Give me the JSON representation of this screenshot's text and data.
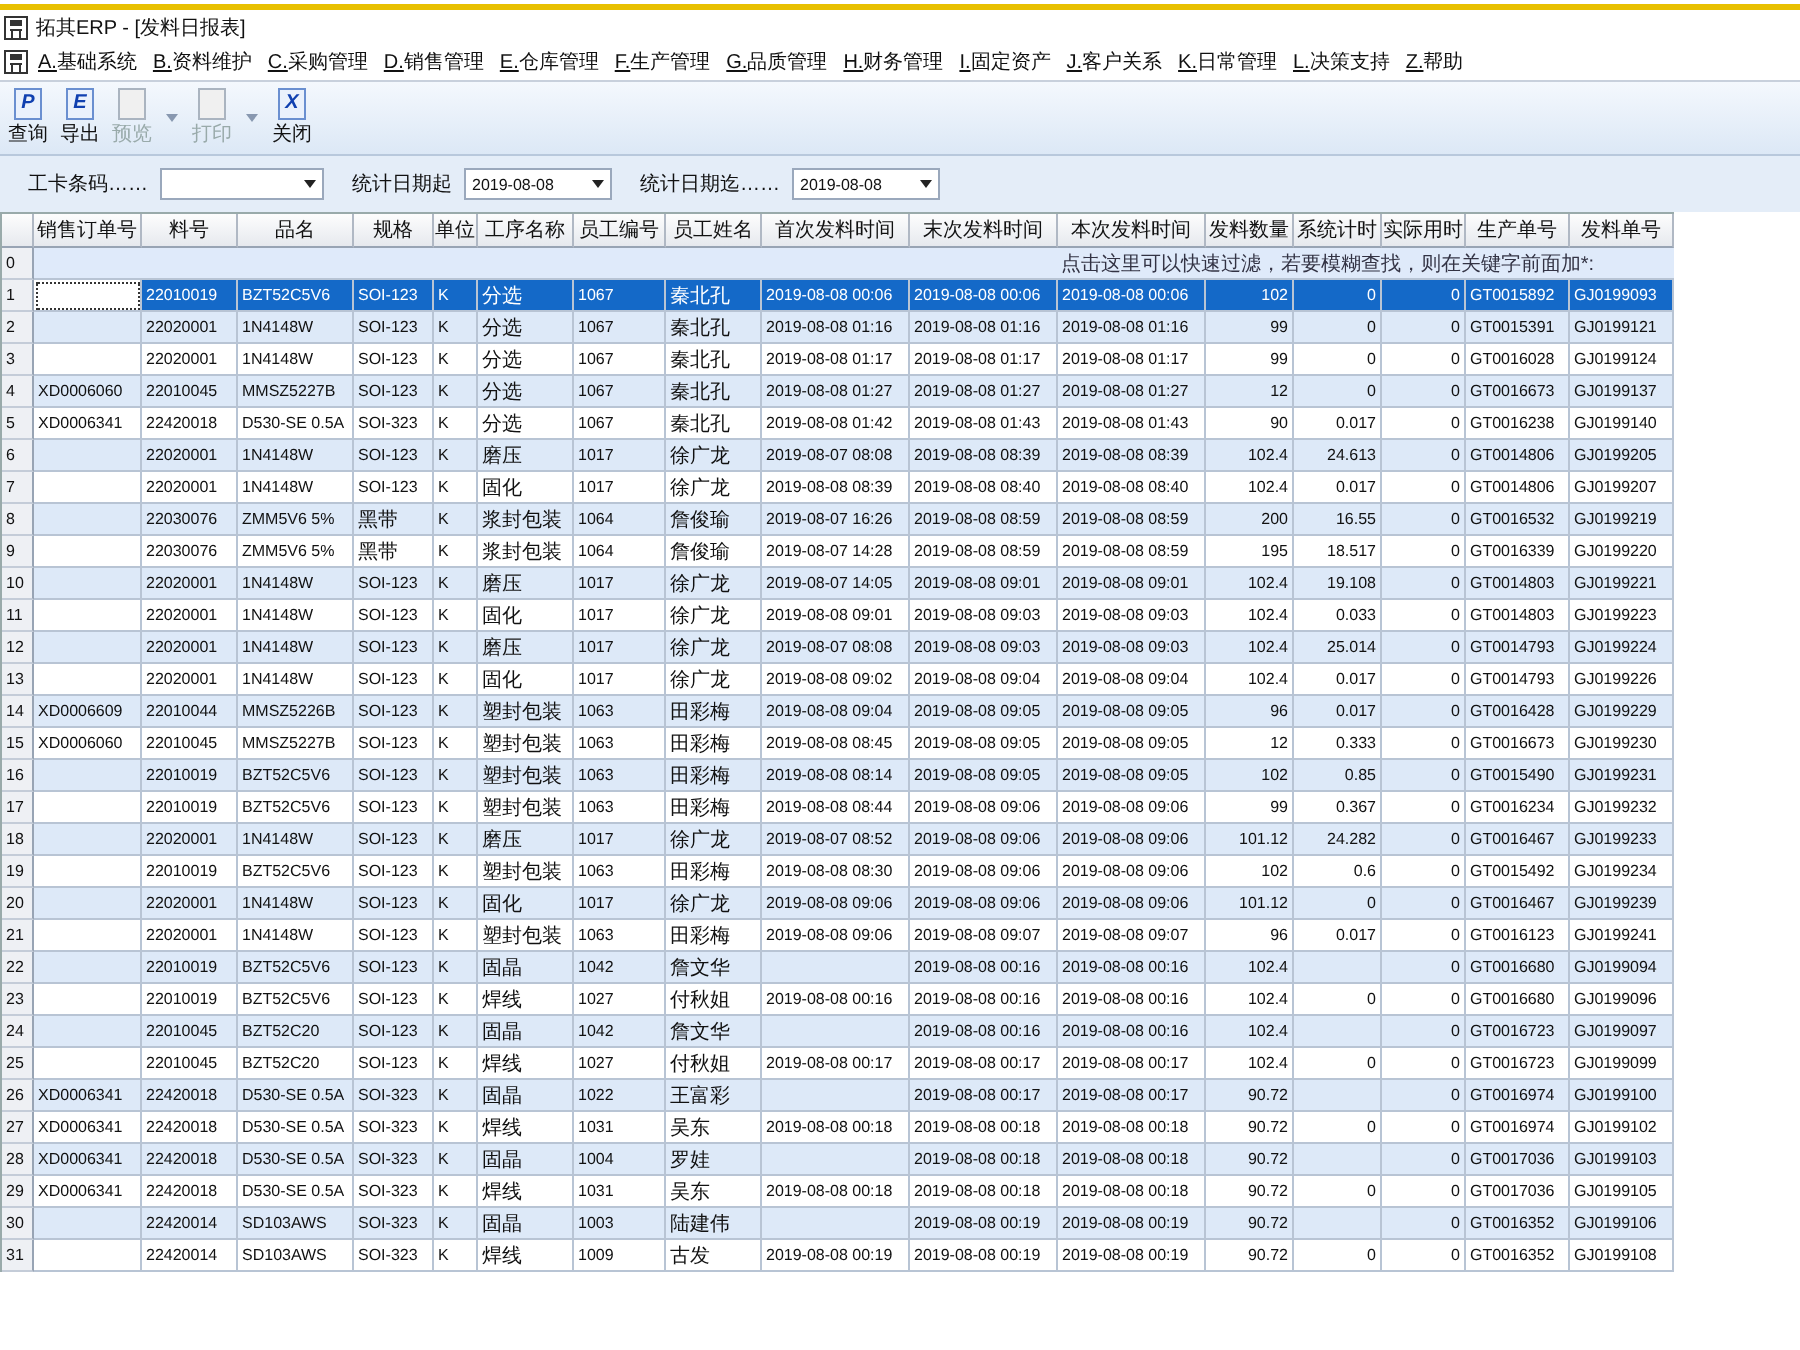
{
  "window": {
    "title": "拓其ERP - [发料日报表]"
  },
  "menu": [
    {
      "label": "A.基础系统"
    },
    {
      "label": "B.资料维护"
    },
    {
      "label": "C.采购管理"
    },
    {
      "label": "D.销售管理"
    },
    {
      "label": "E.仓库管理"
    },
    {
      "label": "F.生产管理"
    },
    {
      "label": "G.品质管理"
    },
    {
      "label": "H.财务管理"
    },
    {
      "label": "I.固定资产"
    },
    {
      "label": "J.客户关系"
    },
    {
      "label": "K.日常管理"
    },
    {
      "label": "L.决策支持"
    },
    {
      "label": "Z.帮助"
    }
  ],
  "toolbar": [
    {
      "glyph": "P",
      "label": "查询",
      "disabled": false,
      "dropdown": false
    },
    {
      "glyph": "E",
      "label": "导出",
      "disabled": false,
      "dropdown": false
    },
    {
      "label": "预览",
      "disabled": true,
      "dropdown": true
    },
    {
      "label": "打印",
      "disabled": true,
      "dropdown": true
    },
    {
      "glyph": "X",
      "label": "关闭",
      "disabled": false,
      "dropdown": false
    }
  ],
  "filters": [
    {
      "label": "工卡条码……"
    },
    {
      "label": "统计日期起",
      "value": "2019-08-08"
    },
    {
      "label": "统计日期迄……",
      "value": "2019-08-08"
    }
  ],
  "table": {
    "columns": [
      {
        "label": "销售订单号",
        "kind": "text"
      },
      {
        "label": "料号",
        "kind": "text"
      },
      {
        "label": "品名",
        "kind": "text"
      },
      {
        "label": "规格",
        "kind": "text"
      },
      {
        "label": "单位",
        "kind": "text"
      },
      {
        "label": "工序名称",
        "kind": "text"
      },
      {
        "label": "员工编号",
        "kind": "text"
      },
      {
        "label": "员工姓名",
        "kind": "text"
      },
      {
        "label": "首次发料时间",
        "kind": "text"
      },
      {
        "label": "末次发料时间",
        "kind": "text"
      },
      {
        "label": "本次发料时间",
        "kind": "text"
      },
      {
        "label": "发料数量",
        "kind": "number"
      },
      {
        "label": "系统计时",
        "kind": "number"
      },
      {
        "label": "实际用时",
        "kind": "number"
      },
      {
        "label": "生产单号",
        "kind": "text"
      },
      {
        "label": "发料单号",
        "kind": "text"
      }
    ],
    "filter_row": {
      "number": "0",
      "hint": "点击这里可以快速过滤，若要模糊查找，则在关键字前面加*:"
    },
    "rows": [
      {
        "number": "1",
        "selected": true,
        "cells": [
          "",
          "22010019",
          "BZT52C5V6",
          "SOI-123",
          "K",
          "分选",
          "1067",
          "秦北孔",
          "2019-08-08 00:06",
          "2019-08-08 00:06",
          "2019-08-08 00:06",
          "102",
          "0",
          "0",
          "GT0015892",
          "GJ0199093"
        ]
      },
      {
        "number": "2",
        "selected": false,
        "cells": [
          "",
          "22020001",
          "1N4148W",
          "SOI-123",
          "K",
          "分选",
          "1067",
          "秦北孔",
          "2019-08-08 01:16",
          "2019-08-08 01:16",
          "2019-08-08 01:16",
          "99",
          "0",
          "0",
          "GT0015391",
          "GJ0199121"
        ]
      },
      {
        "number": "3",
        "selected": false,
        "cells": [
          "",
          "22020001",
          "1N4148W",
          "SOI-123",
          "K",
          "分选",
          "1067",
          "秦北孔",
          "2019-08-08 01:17",
          "2019-08-08 01:17",
          "2019-08-08 01:17",
          "99",
          "0",
          "0",
          "GT0016028",
          "GJ0199124"
        ]
      },
      {
        "number": "4",
        "selected": false,
        "cells": [
          "XD0006060",
          "22010045",
          "MMSZ5227B",
          "SOI-123",
          "K",
          "分选",
          "1067",
          "秦北孔",
          "2019-08-08 01:27",
          "2019-08-08 01:27",
          "2019-08-08 01:27",
          "12",
          "0",
          "0",
          "GT0016673",
          "GJ0199137"
        ]
      },
      {
        "number": "5",
        "selected": false,
        "cells": [
          "XD0006341",
          "22420018",
          "D530-SE 0.5A",
          "SOI-323",
          "K",
          "分选",
          "1067",
          "秦北孔",
          "2019-08-08 01:42",
          "2019-08-08 01:43",
          "2019-08-08 01:43",
          "90",
          "0.017",
          "0",
          "GT0016238",
          "GJ0199140"
        ]
      },
      {
        "number": "6",
        "selected": false,
        "cells": [
          "",
          "22020001",
          "1N4148W",
          "SOI-123",
          "K",
          "磨压",
          "1017",
          "徐广龙",
          "2019-08-07 08:08",
          "2019-08-08 08:39",
          "2019-08-08 08:39",
          "102.4",
          "24.613",
          "0",
          "GT0014806",
          "GJ0199205"
        ]
      },
      {
        "number": "7",
        "selected": false,
        "cells": [
          "",
          "22020001",
          "1N4148W",
          "SOI-123",
          "K",
          "固化",
          "1017",
          "徐广龙",
          "2019-08-08 08:39",
          "2019-08-08 08:40",
          "2019-08-08 08:40",
          "102.4",
          "0.017",
          "0",
          "GT0014806",
          "GJ0199207"
        ]
      },
      {
        "number": "8",
        "selected": false,
        "cells": [
          "",
          "22030076",
          "ZMM5V6 5%",
          "黑带",
          "K",
          "浆封包装",
          "1064",
          "詹俊瑜",
          "2019-08-07 16:26",
          "2019-08-08 08:59",
          "2019-08-08 08:59",
          "200",
          "16.55",
          "0",
          "GT0016532",
          "GJ0199219"
        ]
      },
      {
        "number": "9",
        "selected": false,
        "cells": [
          "",
          "22030076",
          "ZMM5V6 5%",
          "黑带",
          "K",
          "浆封包装",
          "1064",
          "詹俊瑜",
          "2019-08-07 14:28",
          "2019-08-08 08:59",
          "2019-08-08 08:59",
          "195",
          "18.517",
          "0",
          "GT0016339",
          "GJ0199220"
        ]
      },
      {
        "number": "10",
        "selected": false,
        "cells": [
          "",
          "22020001",
          "1N4148W",
          "SOI-123",
          "K",
          "磨压",
          "1017",
          "徐广龙",
          "2019-08-07 14:05",
          "2019-08-08 09:01",
          "2019-08-08 09:01",
          "102.4",
          "19.108",
          "0",
          "GT0014803",
          "GJ0199221"
        ]
      },
      {
        "number": "11",
        "selected": false,
        "cells": [
          "",
          "22020001",
          "1N4148W",
          "SOI-123",
          "K",
          "固化",
          "1017",
          "徐广龙",
          "2019-08-08 09:01",
          "2019-08-08 09:03",
          "2019-08-08 09:03",
          "102.4",
          "0.033",
          "0",
          "GT0014803",
          "GJ0199223"
        ]
      },
      {
        "number": "12",
        "selected": false,
        "cells": [
          "",
          "22020001",
          "1N4148W",
          "SOI-123",
          "K",
          "磨压",
          "1017",
          "徐广龙",
          "2019-08-07 08:08",
          "2019-08-08 09:03",
          "2019-08-08 09:03",
          "102.4",
          "25.014",
          "0",
          "GT0014793",
          "GJ0199224"
        ]
      },
      {
        "number": "13",
        "selected": false,
        "cells": [
          "",
          "22020001",
          "1N4148W",
          "SOI-123",
          "K",
          "固化",
          "1017",
          "徐广龙",
          "2019-08-08 09:02",
          "2019-08-08 09:04",
          "2019-08-08 09:04",
          "102.4",
          "0.017",
          "0",
          "GT0014793",
          "GJ0199226"
        ]
      },
      {
        "number": "14",
        "selected": false,
        "cells": [
          "XD0006609",
          "22010044",
          "MMSZ5226B",
          "SOI-123",
          "K",
          "塑封包装",
          "1063",
          "田彩梅",
          "2019-08-08 09:04",
          "2019-08-08 09:05",
          "2019-08-08 09:05",
          "96",
          "0.017",
          "0",
          "GT0016428",
          "GJ0199229"
        ]
      },
      {
        "number": "15",
        "selected": false,
        "cells": [
          "XD0006060",
          "22010045",
          "MMSZ5227B",
          "SOI-123",
          "K",
          "塑封包装",
          "1063",
          "田彩梅",
          "2019-08-08 08:45",
          "2019-08-08 09:05",
          "2019-08-08 09:05",
          "12",
          "0.333",
          "0",
          "GT0016673",
          "GJ0199230"
        ]
      },
      {
        "number": "16",
        "selected": false,
        "cells": [
          "",
          "22010019",
          "BZT52C5V6",
          "SOI-123",
          "K",
          "塑封包装",
          "1063",
          "田彩梅",
          "2019-08-08 08:14",
          "2019-08-08 09:05",
          "2019-08-08 09:05",
          "102",
          "0.85",
          "0",
          "GT0015490",
          "GJ0199231"
        ]
      },
      {
        "number": "17",
        "selected": false,
        "cells": [
          "",
          "22010019",
          "BZT52C5V6",
          "SOI-123",
          "K",
          "塑封包装",
          "1063",
          "田彩梅",
          "2019-08-08 08:44",
          "2019-08-08 09:06",
          "2019-08-08 09:06",
          "99",
          "0.367",
          "0",
          "GT0016234",
          "GJ0199232"
        ]
      },
      {
        "number": "18",
        "selected": false,
        "cells": [
          "",
          "22020001",
          "1N4148W",
          "SOI-123",
          "K",
          "磨压",
          "1017",
          "徐广龙",
          "2019-08-07 08:52",
          "2019-08-08 09:06",
          "2019-08-08 09:06",
          "101.12",
          "24.282",
          "0",
          "GT0016467",
          "GJ0199233"
        ]
      },
      {
        "number": "19",
        "selected": false,
        "cells": [
          "",
          "22010019",
          "BZT52C5V6",
          "SOI-123",
          "K",
          "塑封包装",
          "1063",
          "田彩梅",
          "2019-08-08 08:30",
          "2019-08-08 09:06",
          "2019-08-08 09:06",
          "102",
          "0.6",
          "0",
          "GT0015492",
          "GJ0199234"
        ]
      },
      {
        "number": "20",
        "selected": false,
        "cells": [
          "",
          "22020001",
          "1N4148W",
          "SOI-123",
          "K",
          "固化",
          "1017",
          "徐广龙",
          "2019-08-08 09:06",
          "2019-08-08 09:06",
          "2019-08-08 09:06",
          "101.12",
          "0",
          "0",
          "GT0016467",
          "GJ0199239"
        ]
      },
      {
        "number": "21",
        "selected": false,
        "cells": [
          "",
          "22020001",
          "1N4148W",
          "SOI-123",
          "K",
          "塑封包装",
          "1063",
          "田彩梅",
          "2019-08-08 09:06",
          "2019-08-08 09:07",
          "2019-08-08 09:07",
          "96",
          "0.017",
          "0",
          "GT0016123",
          "GJ0199241"
        ]
      },
      {
        "number": "22",
        "selected": false,
        "cells": [
          "",
          "22010019",
          "BZT52C5V6",
          "SOI-123",
          "K",
          "固晶",
          "1042",
          "詹文华",
          "",
          "2019-08-08 00:16",
          "2019-08-08 00:16",
          "102.4",
          "",
          "0",
          "GT0016680",
          "GJ0199094"
        ]
      },
      {
        "number": "23",
        "selected": false,
        "cells": [
          "",
          "22010019",
          "BZT52C5V6",
          "SOI-123",
          "K",
          "焊线",
          "1027",
          "付秋姐",
          "2019-08-08 00:16",
          "2019-08-08 00:16",
          "2019-08-08 00:16",
          "102.4",
          "0",
          "0",
          "GT0016680",
          "GJ0199096"
        ]
      },
      {
        "number": "24",
        "selected": false,
        "cells": [
          "",
          "22010045",
          "BZT52C20",
          "SOI-123",
          "K",
          "固晶",
          "1042",
          "詹文华",
          "",
          "2019-08-08 00:16",
          "2019-08-08 00:16",
          "102.4",
          "",
          "0",
          "GT0016723",
          "GJ0199097"
        ]
      },
      {
        "number": "25",
        "selected": false,
        "cells": [
          "",
          "22010045",
          "BZT52C20",
          "SOI-123",
          "K",
          "焊线",
          "1027",
          "付秋姐",
          "2019-08-08 00:17",
          "2019-08-08 00:17",
          "2019-08-08 00:17",
          "102.4",
          "0",
          "0",
          "GT0016723",
          "GJ0199099"
        ]
      },
      {
        "number": "26",
        "selected": false,
        "cells": [
          "XD0006341",
          "22420018",
          "D530-SE 0.5A",
          "SOI-323",
          "K",
          "固晶",
          "1022",
          "王富彩",
          "",
          "2019-08-08 00:17",
          "2019-08-08 00:17",
          "90.72",
          "",
          "0",
          "GT0016974",
          "GJ0199100"
        ]
      },
      {
        "number": "27",
        "selected": false,
        "cells": [
          "XD0006341",
          "22420018",
          "D530-SE 0.5A",
          "SOI-323",
          "K",
          "焊线",
          "1031",
          "吴东",
          "2019-08-08 00:18",
          "2019-08-08 00:18",
          "2019-08-08 00:18",
          "90.72",
          "0",
          "0",
          "GT0016974",
          "GJ0199102"
        ]
      },
      {
        "number": "28",
        "selected": false,
        "cells": [
          "XD0006341",
          "22420018",
          "D530-SE 0.5A",
          "SOI-323",
          "K",
          "固晶",
          "1004",
          "罗娃",
          "",
          "2019-08-08 00:18",
          "2019-08-08 00:18",
          "90.72",
          "",
          "0",
          "GT0017036",
          "GJ0199103"
        ]
      },
      {
        "number": "29",
        "selected": false,
        "cells": [
          "XD0006341",
          "22420018",
          "D530-SE 0.5A",
          "SOI-323",
          "K",
          "焊线",
          "1031",
          "吴东",
          "2019-08-08 00:18",
          "2019-08-08 00:18",
          "2019-08-08 00:18",
          "90.72",
          "0",
          "0",
          "GT0017036",
          "GJ0199105"
        ]
      },
      {
        "number": "30",
        "selected": false,
        "cells": [
          "",
          "22420014",
          "SD103AWS",
          "SOI-323",
          "K",
          "固晶",
          "1003",
          "陆建伟",
          "",
          "2019-08-08 00:19",
          "2019-08-08 00:19",
          "90.72",
          "",
          "0",
          "GT0016352",
          "GJ0199106"
        ]
      },
      {
        "number": "31",
        "selected": false,
        "cells": [
          "",
          "22420014",
          "SD103AWS",
          "SOI-323",
          "K",
          "焊线",
          "1009",
          "古发",
          "2019-08-08 00:19",
          "2019-08-08 00:19",
          "2019-08-08 00:19",
          "90.72",
          "0",
          "0",
          "GT0016352",
          "GJ0199108"
        ]
      }
    ]
  }
}
